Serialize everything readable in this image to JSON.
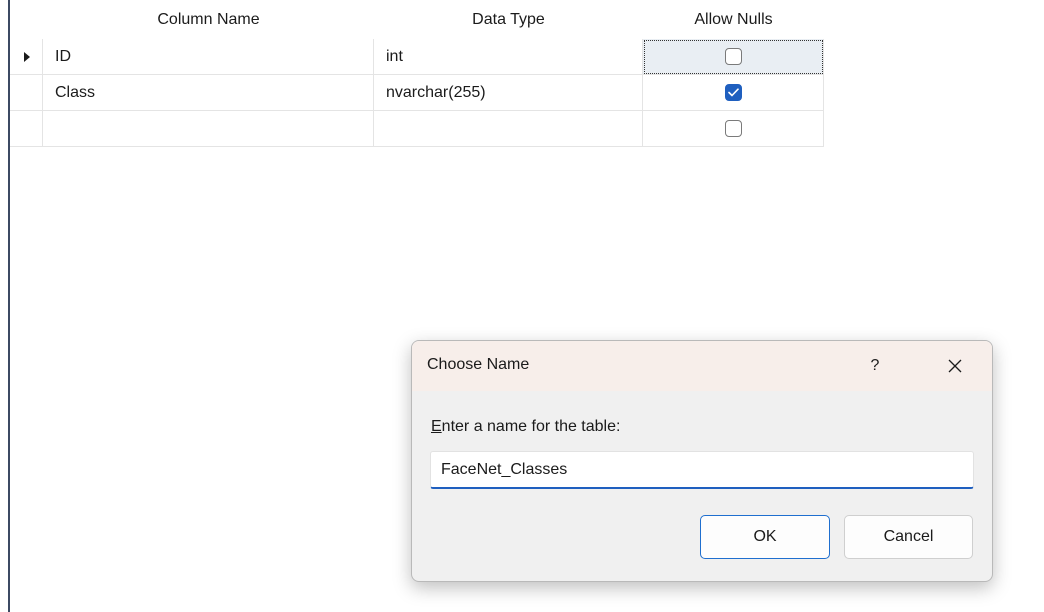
{
  "grid": {
    "headers": {
      "column_name": "Column Name",
      "data_type": "Data Type",
      "allow_nulls": "Allow Nulls"
    },
    "rows": [
      {
        "name": "ID",
        "type": "int",
        "allow_nulls": false,
        "current": true
      },
      {
        "name": "Class",
        "type": "nvarchar(255)",
        "allow_nulls": true,
        "current": false
      },
      {
        "name": "",
        "type": "",
        "allow_nulls": false,
        "current": false
      }
    ]
  },
  "dialog": {
    "title": "Choose Name",
    "help_label": "?",
    "close_icon": "close-icon",
    "prompt_prefix": "",
    "prompt_accel": "E",
    "prompt_rest": "nter a name for the table:",
    "input_value": "FaceNet_Classes",
    "ok_label": "OK",
    "cancel_label": "Cancel"
  },
  "colors": {
    "accent": "#1f5fbf",
    "title_bar": "#f7eeea",
    "dialog_bg": "#f0f0f0"
  }
}
